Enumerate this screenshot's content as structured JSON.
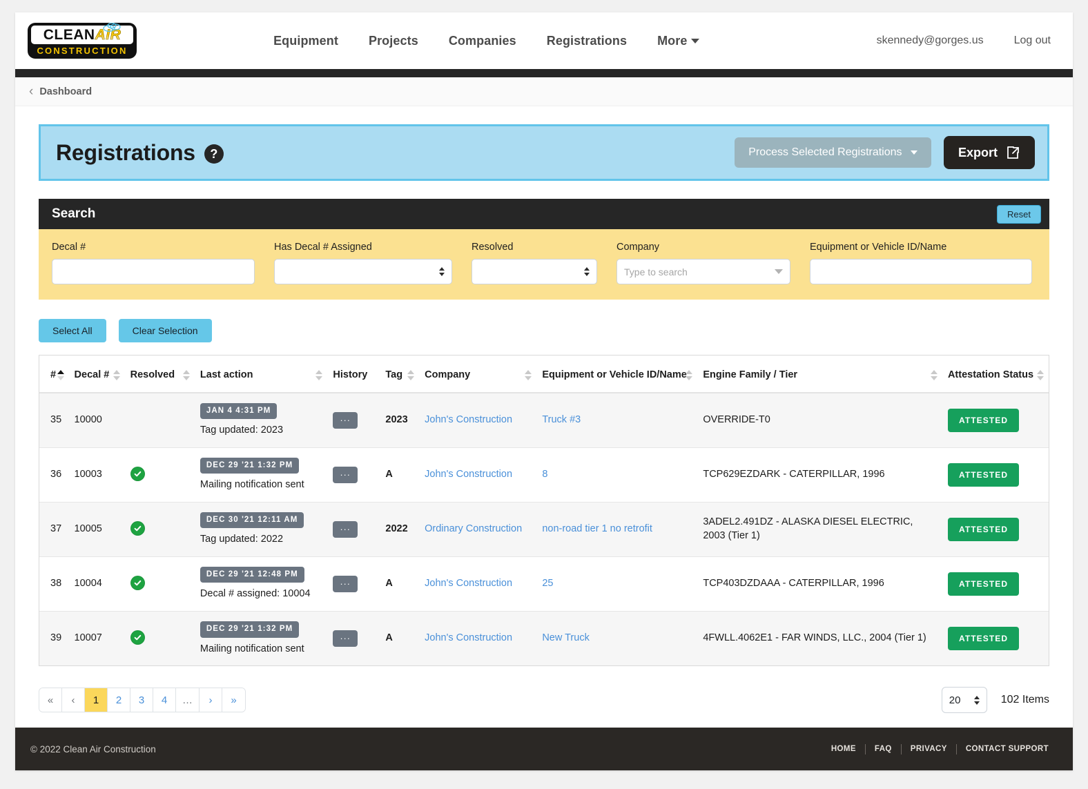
{
  "brand": {
    "logo_primary": "CLEAN",
    "logo_secondary": "AIR",
    "logo_sub": "CONSTRUCTION"
  },
  "nav": {
    "links": [
      {
        "label": "Equipment"
      },
      {
        "label": "Projects"
      },
      {
        "label": "Companies"
      },
      {
        "label": "Registrations"
      },
      {
        "label": "More",
        "has_caret": true
      }
    ],
    "user_email": "skennedy@gorges.us",
    "logout_label": "Log out"
  },
  "breadcrumb": {
    "label": "Dashboard"
  },
  "page_header": {
    "title": "Registrations",
    "help_glyph": "?",
    "process_button": "Process Selected Registrations",
    "export_button": "Export"
  },
  "search": {
    "title": "Search",
    "reset_label": "Reset",
    "fields": [
      {
        "label": "Decal #",
        "type": "text",
        "value": "",
        "placeholder": ""
      },
      {
        "label": "Has Decal # Assigned",
        "type": "select",
        "value": ""
      },
      {
        "label": "Resolved",
        "type": "select",
        "value": ""
      },
      {
        "label": "Company",
        "type": "typeahead",
        "value": "",
        "placeholder": "Type to search"
      },
      {
        "label": "Equipment or Vehicle ID/Name",
        "type": "text",
        "value": "",
        "placeholder": ""
      }
    ]
  },
  "selection": {
    "select_all": "Select All",
    "clear_selection": "Clear Selection"
  },
  "table": {
    "columns": [
      {
        "label": "#",
        "sort": "asc"
      },
      {
        "label": "Decal #",
        "sort": "none"
      },
      {
        "label": "Resolved",
        "sort": "none"
      },
      {
        "label": "Last action",
        "sort": "none"
      },
      {
        "label": "History",
        "sort": "none"
      },
      {
        "label": "Tag",
        "sort": "none"
      },
      {
        "label": "Company",
        "sort": "none"
      },
      {
        "label": "Equipment or Vehicle ID/Name",
        "sort": "none"
      },
      {
        "label": "Engine Family / Tier",
        "sort": "none"
      },
      {
        "label": "Attestation Status",
        "sort": "none"
      }
    ],
    "history_button_label": "...",
    "rows": [
      {
        "num": "35",
        "decal": "10000",
        "resolved": false,
        "timestamp": "JAN 4 4:31 PM",
        "last_action": "Tag updated: 2023",
        "tag": "2023",
        "company": "John's Construction",
        "equipment": "Truck #3",
        "engine": "OVERRIDE-T0",
        "attestation": "ATTESTED"
      },
      {
        "num": "36",
        "decal": "10003",
        "resolved": true,
        "timestamp": "DEC 29 '21 1:32 PM",
        "last_action": "Mailing notification sent",
        "tag": "A",
        "company": "John's Construction",
        "equipment": "8",
        "engine": "TCP629EZDARK - CATERPILLAR, 1996",
        "attestation": "ATTESTED"
      },
      {
        "num": "37",
        "decal": "10005",
        "resolved": true,
        "timestamp": "DEC 30 '21 12:11 AM",
        "last_action": "Tag updated: 2022",
        "tag": "2022",
        "company": "Ordinary Construction",
        "equipment": "non-road tier 1 no retrofit",
        "engine": "3ADEL2.491DZ - ALASKA DIESEL ELECTRIC, 2003 (Tier 1)",
        "attestation": "ATTESTED"
      },
      {
        "num": "38",
        "decal": "10004",
        "resolved": true,
        "timestamp": "DEC 29 '21 12:48 PM",
        "last_action": "Decal # assigned: 10004",
        "tag": "A",
        "company": "John's Construction",
        "equipment": "25",
        "engine": "TCP403DZDAAA - CATERPILLAR, 1996",
        "attestation": "ATTESTED"
      },
      {
        "num": "39",
        "decal": "10007",
        "resolved": true,
        "timestamp": "DEC 29 '21 1:32 PM",
        "last_action": "Mailing notification sent",
        "tag": "A",
        "company": "John's Construction",
        "equipment": "New Truck",
        "engine": "4FWLL.4062E1 - FAR WINDS, LLC., 2004 (Tier 1)",
        "attestation": "ATTESTED"
      }
    ]
  },
  "pagination": {
    "buttons": [
      {
        "label": "«",
        "kind": "muted"
      },
      {
        "label": "‹",
        "kind": "muted"
      },
      {
        "label": "1",
        "kind": "active"
      },
      {
        "label": "2",
        "kind": "link"
      },
      {
        "label": "3",
        "kind": "link"
      },
      {
        "label": "4",
        "kind": "link"
      },
      {
        "label": "…",
        "kind": "dots"
      },
      {
        "label": "›",
        "kind": "link"
      },
      {
        "label": "»",
        "kind": "link"
      }
    ],
    "per_page": "20",
    "items_count": "102 Items"
  },
  "footer": {
    "copyright": "© 2022 Clean Air Construction",
    "links": [
      {
        "label": "HOME"
      },
      {
        "label": "FAQ"
      },
      {
        "label": "PRIVACY"
      },
      {
        "label": "CONTACT SUPPORT"
      }
    ]
  },
  "colors": {
    "header_band": "#abdcf2",
    "header_band_border": "#62c4ea",
    "search_body": "#fbe191",
    "accent_blue": "#65c7e8",
    "attested_green": "#16a05c",
    "active_page": "#fbd75b",
    "dark": "#262626"
  }
}
